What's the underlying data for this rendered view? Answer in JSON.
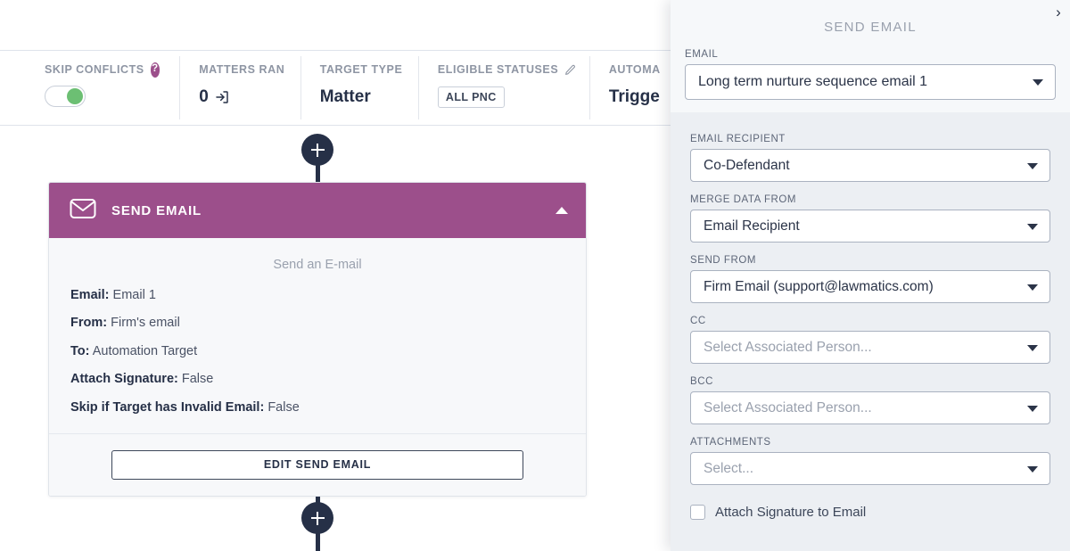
{
  "stats_bar": {
    "columns": [
      {
        "label": "SKIP CONFLICTS",
        "icon": "help-circle-icon",
        "control": "toggle",
        "toggle_on": true,
        "value": ""
      },
      {
        "label": "MATTERS RAN",
        "value": "0",
        "value_icon": "sign-in-arrow-icon"
      },
      {
        "label": "TARGET TYPE",
        "value": "Matter"
      },
      {
        "label": "ELIGIBLE STATUSES",
        "icon": "pencil-icon",
        "badge": "ALL PNC"
      },
      {
        "label": "AUTOMA",
        "value": "Trigge"
      }
    ]
  },
  "flow": {
    "add_step_top_label": "+",
    "add_step_bottom_label": "+",
    "node": {
      "header_title": "SEND EMAIL",
      "header_icon": "envelope-icon",
      "collapse_icon": "caret-up-icon",
      "subtitle": "Send an E-mail",
      "details": [
        {
          "key": "Email:",
          "value": "Email 1"
        },
        {
          "key": "From:",
          "value": "Firm's email"
        },
        {
          "key": "To:",
          "value": "Automation Target"
        },
        {
          "key": "Attach Signature:",
          "value": "False"
        },
        {
          "key": "Skip if Target has Invalid Email:",
          "value": "False"
        }
      ],
      "edit_button": "EDIT SEND EMAIL"
    }
  },
  "panel": {
    "title": "SEND EMAIL",
    "close_icon": "chevron-right-icon",
    "email_field": {
      "label": "EMAIL",
      "value": "Long term nurture sequence email 1"
    },
    "fields": [
      {
        "label": "EMAIL RECIPIENT",
        "value": "Co-Defendant",
        "placeholder": "",
        "is_placeholder": false
      },
      {
        "label": "MERGE DATA FROM",
        "value": "Email Recipient",
        "placeholder": "",
        "is_placeholder": false
      },
      {
        "label": "SEND FROM",
        "value": "Firm Email (support@lawmatics.com)",
        "placeholder": "",
        "is_placeholder": false
      },
      {
        "label": "CC",
        "value": "Select Associated Person...",
        "placeholder": "Select Associated Person...",
        "is_placeholder": true
      },
      {
        "label": "BCC",
        "value": "Select Associated Person...",
        "placeholder": "Select Associated Person...",
        "is_placeholder": true
      },
      {
        "label": "ATTACHMENTS",
        "value": "Select...",
        "placeholder": "Select...",
        "is_placeholder": true
      }
    ],
    "attach_signature": {
      "label": "Attach Signature to Email",
      "checked": false
    }
  },
  "colors": {
    "accent_purple": "#9c4f8b",
    "navy": "#263047",
    "toggle_green": "#6cbf73",
    "panel_bg": "#eceff3",
    "card_body_bg": "#f7f8fa"
  }
}
